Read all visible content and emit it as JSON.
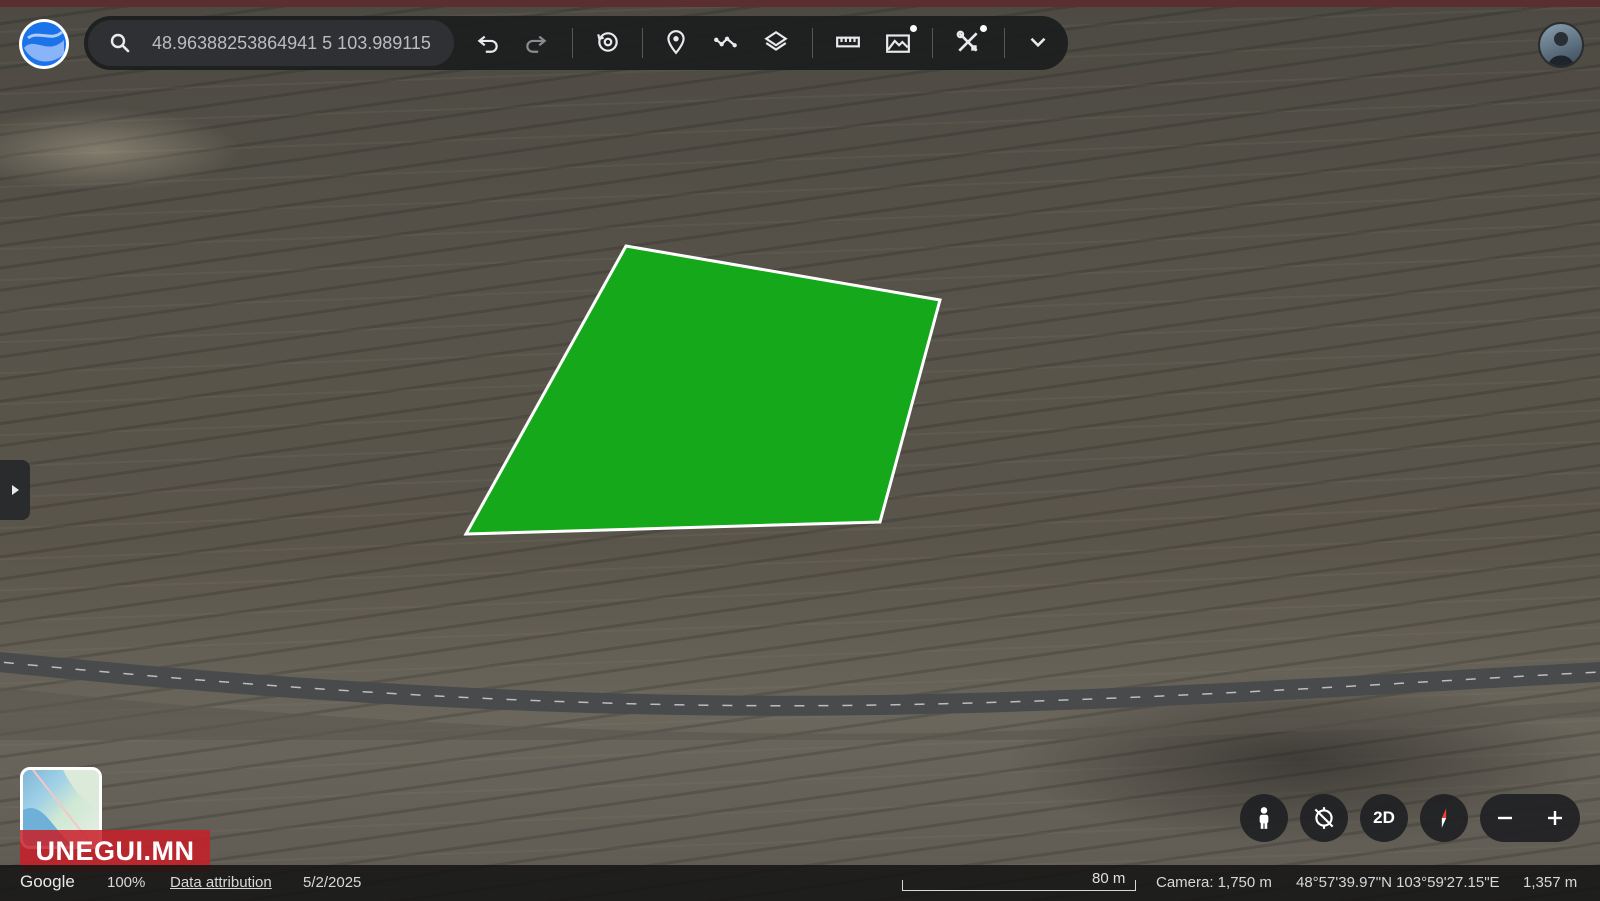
{
  "search": {
    "value": "48.96388253864941 5 103.989115"
  },
  "toolbar": {
    "tools": [
      "undo-icon",
      "redo-icon",
      "history-icon",
      "placemark-icon",
      "path-icon",
      "layers-icon",
      "ruler-icon",
      "terrain-icon",
      "tools-icon",
      "chevron-down-icon"
    ]
  },
  "watermark": {
    "text": "UNEGUI.MN"
  },
  "controls": {
    "view_mode_label": "2D"
  },
  "status": {
    "brand": "Google",
    "zoom": "100%",
    "attribution": "Data attribution",
    "date": "5/2/2025",
    "scale": "80 m",
    "camera": "Camera: 1,750 m",
    "coordinates": "48°57'39.97\"N 103°59'27.15\"E",
    "elevation": "1,357 m"
  },
  "colors": {
    "polygon_fill": "#15a81b",
    "polygon_stroke": "#ffffff",
    "toolbar_bg": "#1c1d1f",
    "watermark_bg": "#c81e28"
  }
}
